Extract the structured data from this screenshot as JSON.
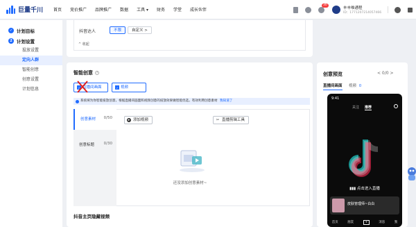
{
  "logo": {
    "text": "巨量千川"
  },
  "nav": {
    "items": [
      "首页",
      "竞价推广",
      "品牌推广",
      "数据",
      "工具 ▾",
      "财务",
      "学堂",
      "成长伙伴"
    ],
    "notification_count": "30",
    "user_name": "丰丰唯通程",
    "user_id": "ID：1771207214057466"
  },
  "sidebar": {
    "steps": [
      {
        "icon": "✓",
        "label": "计划目标"
      },
      {
        "icon": "2",
        "label": "计划设置"
      }
    ],
    "subs": [
      "投放设置",
      "定向人群",
      "智能创意",
      "创意设置",
      "计划信息"
    ],
    "active_sub": "定向人群"
  },
  "targeting": {
    "label": "抖音达人",
    "options": [
      "不限",
      "自定义 >"
    ],
    "selected": "不限",
    "collapse_label": "^ 收起"
  },
  "creative": {
    "title": "智能创意",
    "help": "?",
    "tabs": [
      "直播间画面",
      "视频"
    ],
    "tip": "系统将为你智能投放创意，根据直播间画面和视频创意的投放效果做智能优选，有效利用创意素材",
    "tip_link": "我知道了",
    "categories": [
      {
        "label": "创意素材",
        "count": "0/50"
      },
      {
        "label": "创意标题",
        "count": "0/30"
      }
    ],
    "add_video": "添加视频",
    "clip_tool": "直播剪辑工具",
    "empty_text": "还没添加创意素材~",
    "bottom_title": "抖音主页隐藏视频"
  },
  "preview": {
    "title": "创意预览",
    "pager": "< 0/0 >",
    "tabs": [
      "直播间画面",
      "视频"
    ],
    "tab_badge": "0",
    "phone": {
      "time": "9:41",
      "tab_follow": "关注",
      "tab_recommend": "推荐",
      "live_text": "点击进入直播",
      "streamer": "皮肤管理师~白白",
      "bottom": [
        "首页",
        "朋友",
        "+",
        "消息",
        "我"
      ]
    }
  },
  "colors": {
    "accent": "#1f6bff",
    "brand": "#1f3c88",
    "tip_bg": "#e8efff",
    "badge": "#f53f3f"
  },
  "icons": [
    "logo-bars-icon",
    "doc-icon",
    "help-icon",
    "bell-icon",
    "settings-icon",
    "tiktok-icon",
    "check-icon",
    "play-icon",
    "scissors-icon",
    "search-icon"
  ]
}
